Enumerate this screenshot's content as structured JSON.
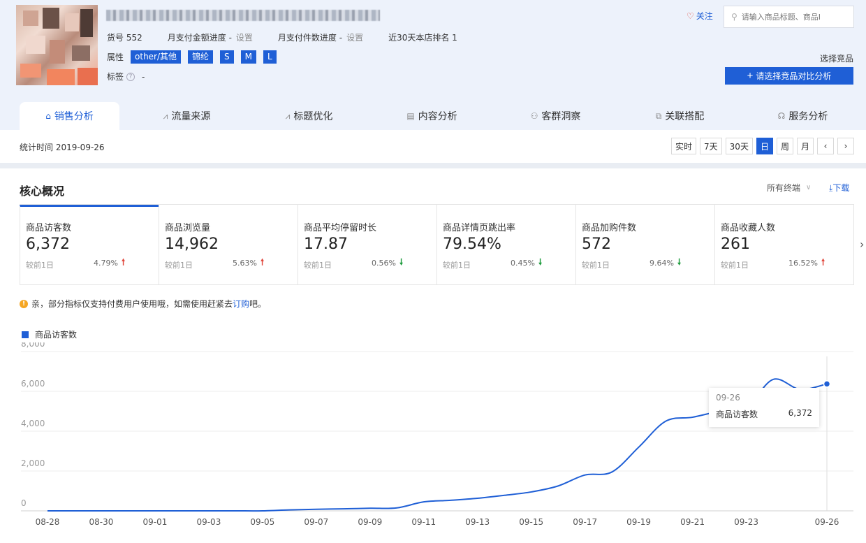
{
  "product": {
    "sku_label": "货号",
    "sku_value": "552",
    "pay_amount_label": "月支付金额进度 -",
    "pay_amount_link": "设置",
    "pay_count_label": "月支付件数进度 -",
    "pay_count_link": "设置",
    "rank_text": "近30天本店排名 1",
    "attr_label": "属性",
    "attrs": [
      "other/其他",
      "锦纶",
      "S",
      "M",
      "L"
    ],
    "tag_label": "标签",
    "tag_help": "?",
    "tag_value": "-"
  },
  "header": {
    "follow_label": "关注",
    "search_placeholder": "请输入商品标题、商品I",
    "pick_label": "选择竞品",
    "compare_button": "请选择竞品对比分析",
    "accent": "#1f5fd6"
  },
  "tabs": [
    {
      "label": "销售分析",
      "icon": "bag-icon",
      "glyph": "⌂"
    },
    {
      "label": "流量来源",
      "icon": "line-chart-icon",
      "glyph": "⩘"
    },
    {
      "label": "标题优化",
      "icon": "line-chart-icon",
      "glyph": "⩘"
    },
    {
      "label": "内容分析",
      "icon": "document-icon",
      "glyph": "▤"
    },
    {
      "label": "客群洞察",
      "icon": "users-icon",
      "glyph": "⚇"
    },
    {
      "label": "关联搭配",
      "icon": "link-icon",
      "glyph": "⧉"
    },
    {
      "label": "服务分析",
      "icon": "headset-icon",
      "glyph": "☊"
    }
  ],
  "datebar": {
    "stat_time": "统计时间 2019-09-26",
    "ranges": [
      "实时",
      "7天",
      "30天",
      "日",
      "周",
      "月"
    ],
    "active_range": "日"
  },
  "core": {
    "title": "核心概况",
    "terminal": "所有终端",
    "download": "下载",
    "compare_label": "较前1日",
    "metrics": [
      {
        "name": "商品访客数",
        "value": "6,372",
        "change": "4.79%",
        "dir": "up"
      },
      {
        "name": "商品浏览量",
        "value": "14,962",
        "change": "5.63%",
        "dir": "up"
      },
      {
        "name": "商品平均停留时长",
        "value": "17.87",
        "change": "0.56%",
        "dir": "down"
      },
      {
        "name": "商品详情页跳出率",
        "value": "79.54%",
        "change": "0.45%",
        "dir": "down"
      },
      {
        "name": "商品加购件数",
        "value": "572",
        "change": "9.64%",
        "dir": "down"
      },
      {
        "name": "商品收藏人数",
        "value": "261",
        "change": "16.52%",
        "dir": "up"
      }
    ],
    "next_arrow": "›"
  },
  "notice": {
    "text_before": "亲，部分指标仅支持付费用户使用哦，如需使用赶紧去",
    "link": "订购",
    "text_after": "吧。"
  },
  "chart_data": {
    "type": "line",
    "series": [
      {
        "name": "商品访客数",
        "color": "#1f5fd6",
        "x": [
          "08-28",
          "08-29",
          "08-30",
          "08-31",
          "09-01",
          "09-02",
          "09-03",
          "09-04",
          "09-05",
          "09-06",
          "09-07",
          "09-08",
          "09-09",
          "09-10",
          "09-11",
          "09-12",
          "09-13",
          "09-14",
          "09-15",
          "09-16",
          "09-17",
          "09-18",
          "09-19",
          "09-20",
          "09-21",
          "09-22",
          "09-23",
          "09-24",
          "09-25",
          "09-26"
        ],
        "values": [
          0,
          0,
          0,
          0,
          0,
          0,
          0,
          0,
          0,
          50,
          80,
          100,
          130,
          150,
          450,
          530,
          630,
          780,
          950,
          1250,
          1800,
          1950,
          3200,
          4500,
          4700,
          5000,
          5200,
          6600,
          6100,
          6372
        ]
      }
    ],
    "x_tick_labels": [
      "08-28",
      "08-30",
      "09-01",
      "09-03",
      "09-05",
      "09-07",
      "09-09",
      "09-11",
      "09-13",
      "09-15",
      "09-17",
      "09-19",
      "09-21",
      "09-23",
      "09-26"
    ],
    "y_ticks": [
      0,
      2000,
      4000,
      6000,
      8000
    ],
    "y_tick_labels": [
      "0",
      "2,000",
      "4,000",
      "6,000",
      "8,000"
    ],
    "ylim": [
      0,
      8000
    ],
    "grid": true,
    "legend": "top-left",
    "tooltip": {
      "date": "09-26",
      "label": "商品访客数",
      "value": "6,372"
    }
  }
}
